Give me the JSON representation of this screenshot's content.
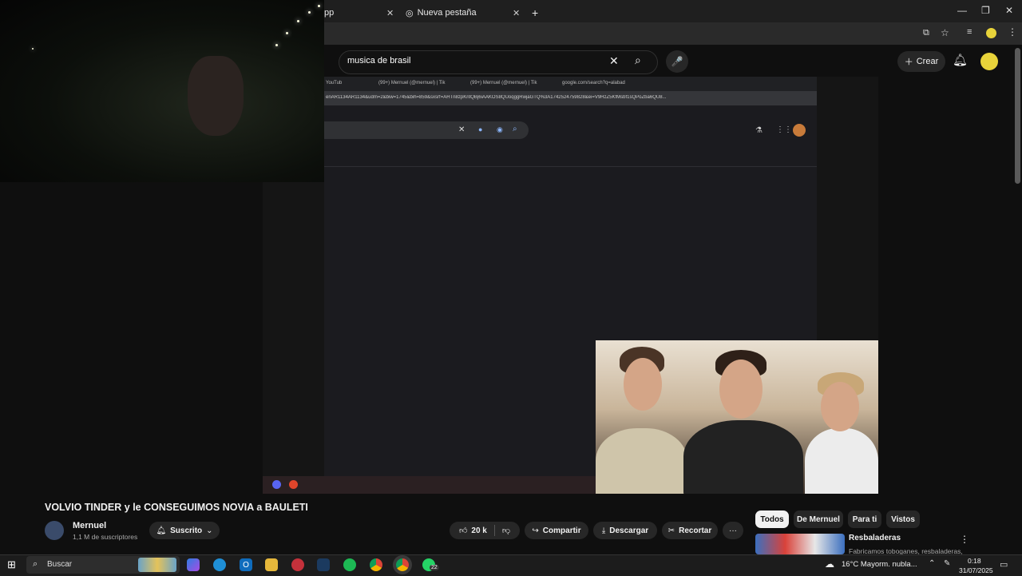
{
  "browser": {
    "tabs": [
      {
        "label": "pp"
      },
      {
        "label": "Nueva pestaña"
      }
    ],
    "new_tab": "+"
  },
  "header": {
    "search_value": "musica de brasil",
    "create_label": "Crear"
  },
  "inner_browser": {
    "tabs": [
      "YouTub",
      "(99+) Mernuel (@mernuel) | Tik",
      "(99+) Mernuel (@mernuel) | Tik",
      "google.com/search?q=alabad"
    ],
    "url": "enAR1134AR1134&udm=2&biw=1745&bih=859&sxsrf=AHTn8zpKntQBj6iAAKOS8QUoqggRwjaGTQ%3A1742524759828&ei=V9HzZ5KfMsbf1sQPoZba6QU8..."
  },
  "video": {
    "title": "VOLVIO TINDER y le CONSEGUIMOS NOVIA a BAULETI",
    "channel": "Mernuel",
    "subscribers": "1,1 M de suscriptores",
    "subscribed_label": "Suscrito",
    "likes": "20 k",
    "share_label": "Compartir",
    "download_label": "Descargar",
    "clip_label": "Recortar",
    "more": "···"
  },
  "chips": [
    "Todos",
    "De Mernuel",
    "Para ti",
    "Vistos"
  ],
  "recommendation": {
    "title": "Resbaladeras",
    "subtitle": "Fabricamos toboganes, resbaladeras,"
  },
  "taskbar": {
    "search_placeholder": "Buscar",
    "whatsapp_badge": "22",
    "weather": "16°C  Mayorm. nubla...",
    "time": "0:18",
    "date": "31/07/2025"
  },
  "colors": {
    "background": "#0f0f0f",
    "chip_active": "#f1f1f1",
    "surface": "#272727"
  }
}
